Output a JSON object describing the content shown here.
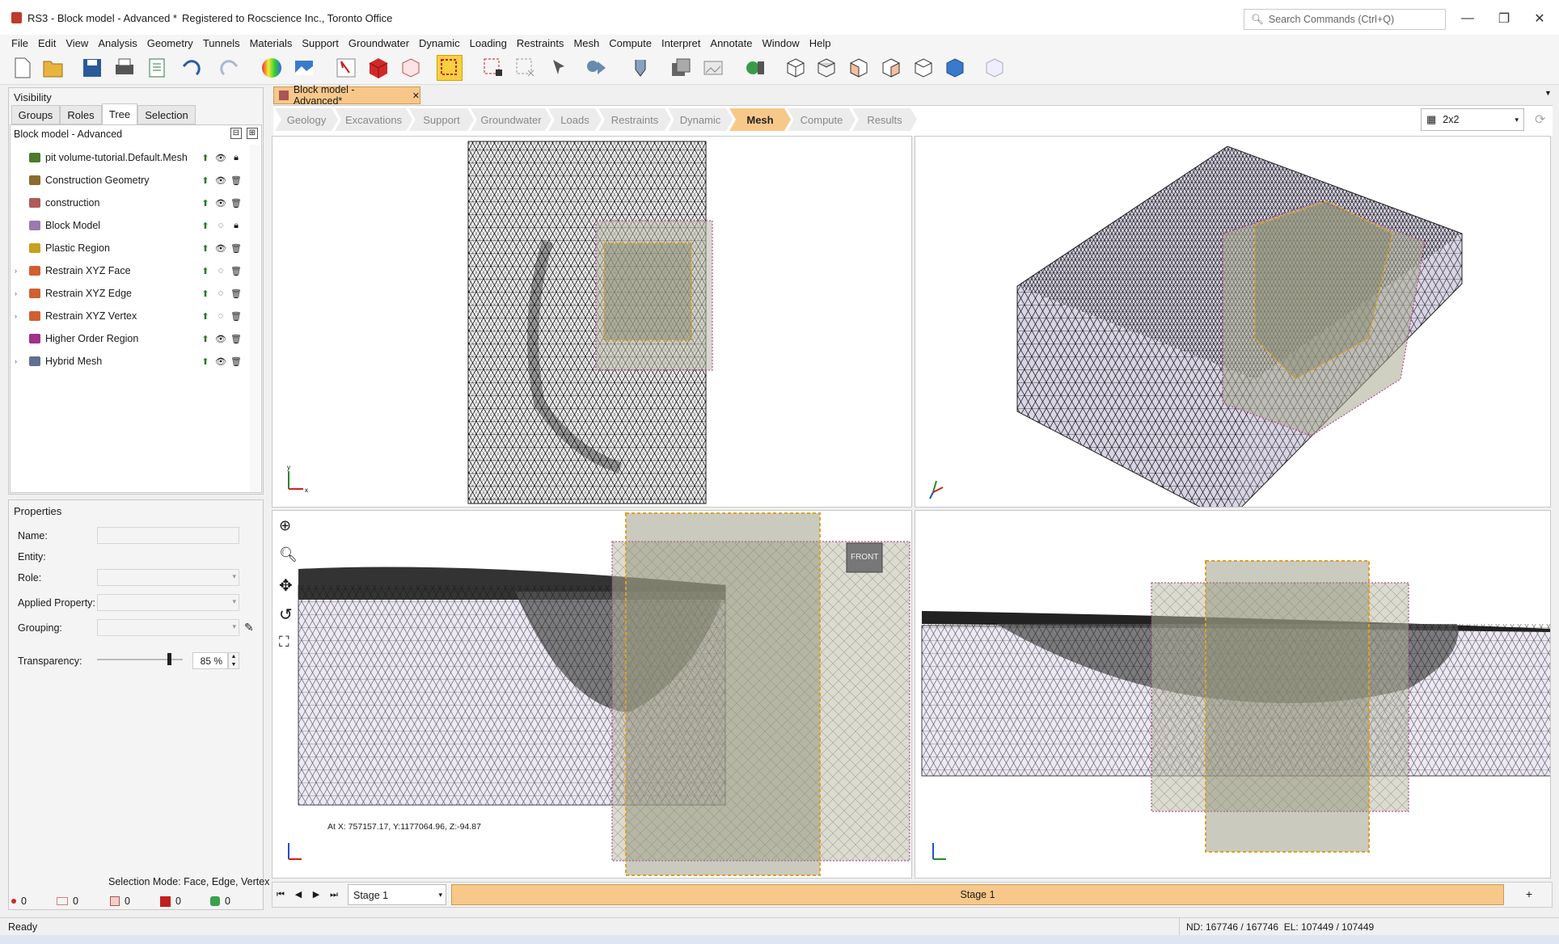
{
  "window": {
    "title": "RS3 - Block model - Advanced *",
    "registered": "Registered to Rocscience Inc., Toronto Office",
    "search_placeholder": "Search Commands (Ctrl+Q)"
  },
  "menu": [
    "File",
    "Edit",
    "View",
    "Analysis",
    "Geometry",
    "Tunnels",
    "Materials",
    "Support",
    "Groundwater",
    "Dynamic",
    "Loading",
    "Restraints",
    "Mesh",
    "Compute",
    "Interpret",
    "Annotate",
    "Window",
    "Help"
  ],
  "visibility": {
    "title": "Visibility",
    "tabs": [
      "Groups",
      "Roles",
      "Tree",
      "Selection"
    ],
    "active_tab": "Tree",
    "model_name": "Block model - Advanced",
    "items": [
      {
        "label": "pit volume-tutorial.Default.Mesh",
        "icon": "mesh-surface-icon",
        "visible": "eye-icon",
        "lock": "lock-icon",
        "expand": false
      },
      {
        "label": "Construction Geometry",
        "icon": "construction-geometry-icon",
        "visible": "eye-icon",
        "lock": "delete-icon",
        "expand": false
      },
      {
        "label": "construction",
        "icon": "construction-icon",
        "visible": "eye-icon",
        "lock": "delete-icon",
        "expand": false
      },
      {
        "label": "Block Model",
        "icon": "block-model-icon",
        "visible": "eye-hidden-icon",
        "lock": "lock-icon",
        "expand": false
      },
      {
        "label": "Plastic Region",
        "icon": "plastic-region-icon",
        "visible": "eye-icon",
        "lock": "delete-icon",
        "expand": false
      },
      {
        "label": "Restrain XYZ Face",
        "icon": "restrain-face-icon",
        "visible": "eye-hidden-icon",
        "lock": "delete-icon",
        "expand": true
      },
      {
        "label": "Restrain XYZ Edge",
        "icon": "restrain-edge-icon",
        "visible": "eye-hidden-icon",
        "lock": "delete-icon",
        "expand": true
      },
      {
        "label": "Restrain XYZ Vertex",
        "icon": "restrain-vertex-icon",
        "visible": "eye-hidden-icon",
        "lock": "delete-icon",
        "expand": true
      },
      {
        "label": "Higher Order Region",
        "icon": "higher-order-region-icon",
        "visible": "eye-icon",
        "lock": "delete-icon",
        "expand": false
      },
      {
        "label": "Hybrid Mesh",
        "icon": "hybrid-mesh-icon",
        "visible": "eye-icon",
        "lock": "delete-icon",
        "expand": true
      }
    ]
  },
  "properties": {
    "title": "Properties",
    "name_label": "Name:",
    "entity_label": "Entity:",
    "role_label": "Role:",
    "applied_label": "Applied Property:",
    "grouping_label": "Grouping:",
    "transparency_label": "Transparency:",
    "transparency_value": "85 %",
    "transparency_fraction": 0.85,
    "selection_mode": "Selection Mode: Face, Edge, Vertex",
    "counts": [
      "0",
      "0",
      "0",
      "0",
      "0"
    ]
  },
  "doc_tab": {
    "label": "Block model - Advanced*"
  },
  "workflow": {
    "steps": [
      "Geology",
      "Excavations",
      "Support",
      "Groundwater",
      "Loads",
      "Restraints",
      "Dynamic",
      "Mesh",
      "Compute",
      "Results"
    ],
    "active": "Mesh"
  },
  "layout_select": "2x2",
  "viewports": {
    "cursor_readout": "At X: 757157.17, Y:1177064.96, Z:-94.87",
    "front_label": "FRONT"
  },
  "stage": {
    "select": "Stage 1",
    "bar": "Stage 1",
    "add": "+"
  },
  "status": {
    "left": "Ready",
    "right": "ND: 167746 / 167746  EL: 107449 / 107449"
  },
  "colors": {
    "active_step": "#f8c88a",
    "stage_bar": "#f8c88a",
    "box_orange": "#e0a020",
    "box_magenta": "#b0308a"
  }
}
